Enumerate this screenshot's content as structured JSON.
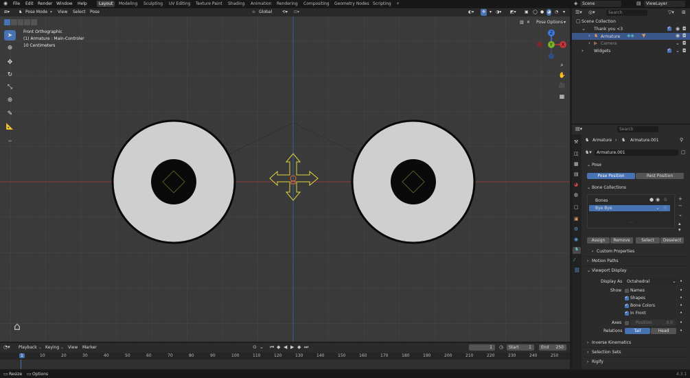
{
  "menu": [
    "File",
    "Edit",
    "Render",
    "Window",
    "Help"
  ],
  "workspaces": [
    "Layout",
    "Modeling",
    "Sculpting",
    "UV Editing",
    "Texture Paint",
    "Shading",
    "Animation",
    "Rendering",
    "Compositing",
    "Geometry Nodes",
    "Scripting"
  ],
  "scene": {
    "name": "Scene",
    "view_layer": "ViewLayer"
  },
  "viewport": {
    "mode": "Pose Mode",
    "menus": [
      "View",
      "Select",
      "Pose"
    ],
    "orientation": "Global",
    "pose_options": "Pose Options",
    "overlay_lines": [
      "Front Orthographic",
      "(1) Armature : Main-Controler",
      "10 Centimeters"
    ]
  },
  "outliner": {
    "search_placeholder": "Search",
    "items": [
      "Scene Collection",
      "Thank you <3",
      "Armature",
      "Camera",
      "Widgets"
    ]
  },
  "properties": {
    "search_placeholder": "Search",
    "breadcrumb": [
      "Armature",
      "Armature.001"
    ],
    "data_name": "Armature.001",
    "pose_header": "Pose",
    "pose_position": "Pose Position",
    "rest_position": "Rest Position",
    "bone_collections_header": "Bone Collections",
    "collections": [
      "Bones",
      "Bye Bye"
    ],
    "assign": "Assign",
    "remove": "Remove",
    "select": "Select",
    "deselect": "Deselect",
    "custom_properties": "Custom Properties",
    "motion_paths": "Motion Paths",
    "viewport_display": "Viewport Display",
    "display_as_label": "Display As",
    "display_as": "Octahedral",
    "show_label": "Show",
    "show_items": [
      "Names",
      "Shapes",
      "Bone Colors",
      "In Front"
    ],
    "axes_label": "Axes",
    "position_label": "Position",
    "position_value": "0.0",
    "relations_label": "Relations",
    "tail": "Tail",
    "head": "Head",
    "inverse_kinematics": "Inverse Kinematics",
    "selection_sets": "Selection Sets",
    "rigify": "Rigify"
  },
  "timeline": {
    "menus": [
      "Playback",
      "Keying",
      "View",
      "Marker"
    ],
    "current_frame": "1",
    "start_label": "Start",
    "start": "1",
    "end_label": "End",
    "end": "250",
    "ticks": [
      "1",
      "10",
      "20",
      "30",
      "40",
      "50",
      "60",
      "70",
      "80",
      "90",
      "100",
      "110",
      "120",
      "130",
      "140",
      "150",
      "160",
      "170",
      "180",
      "190",
      "200",
      "210",
      "220",
      "230",
      "240",
      "250"
    ]
  },
  "status": {
    "left": [
      "Resize",
      "Options"
    ],
    "version": "4.3.1"
  },
  "colors": {
    "accent": "#4772b3",
    "x_axis": "#c8353c",
    "y_axis": "#7ab325",
    "z_axis": "#3f7ae0",
    "bone": "#e0d83a"
  }
}
